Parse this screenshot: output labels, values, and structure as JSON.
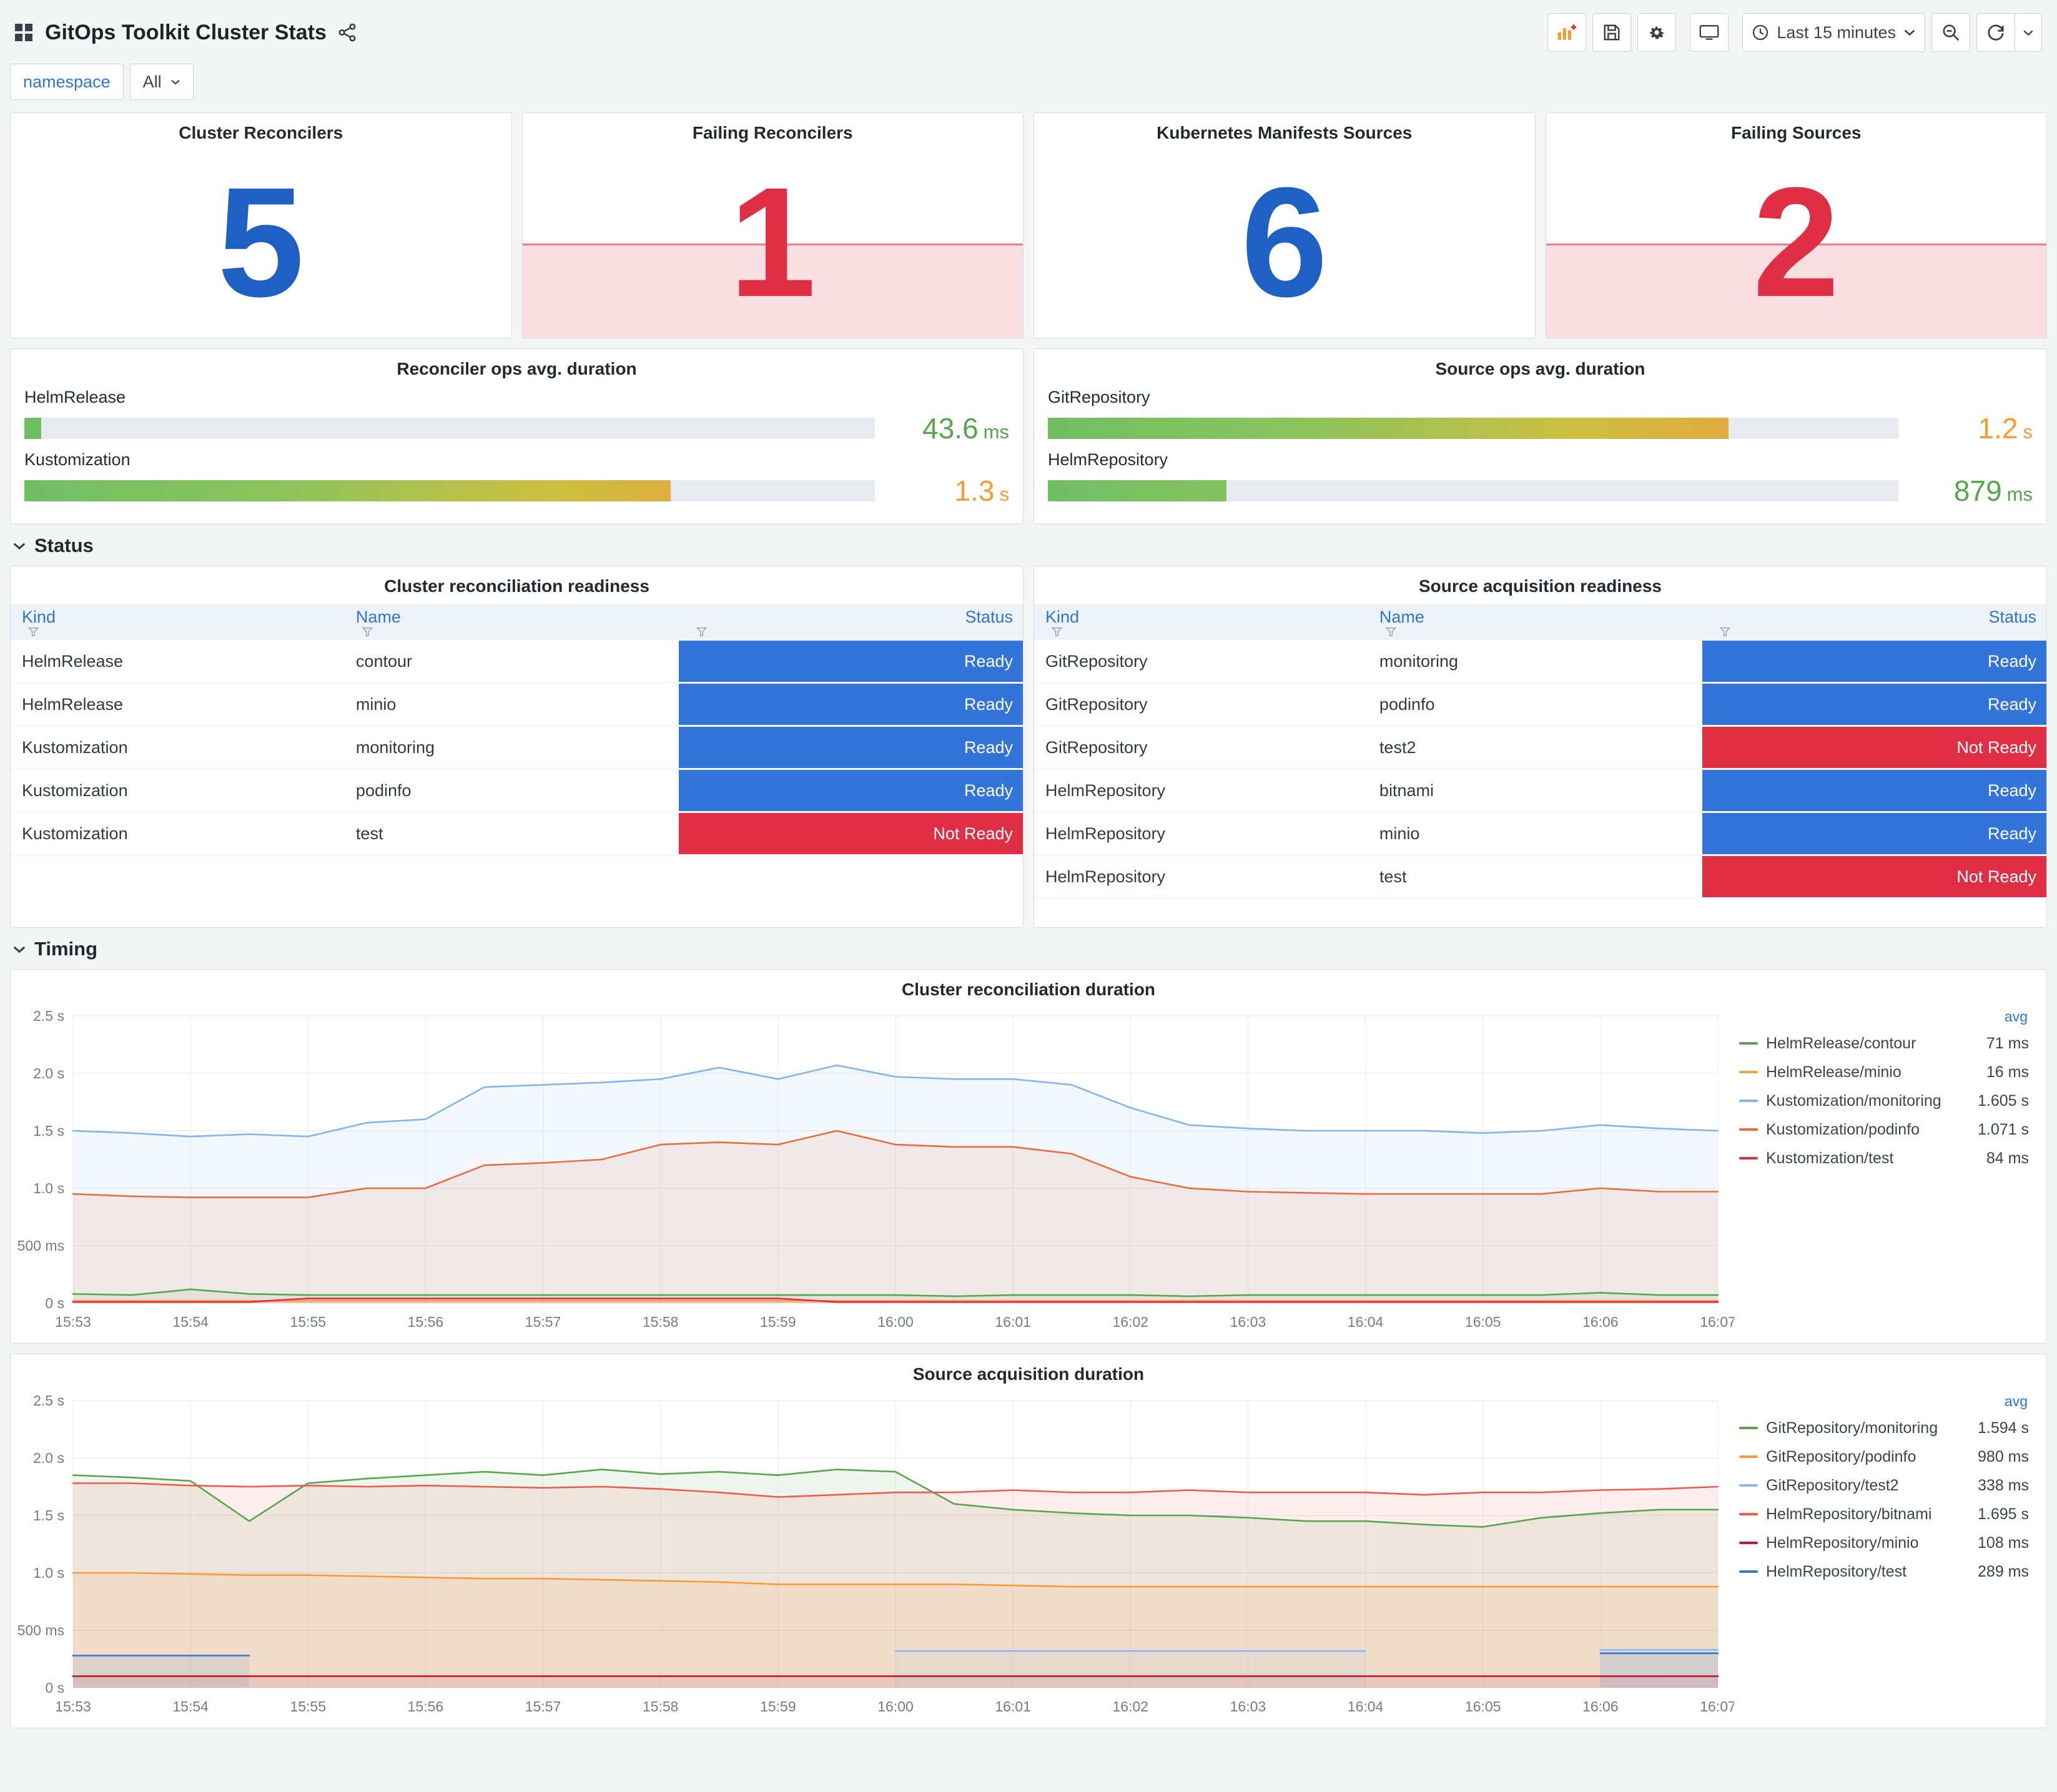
{
  "header": {
    "title": "GitOps Toolkit Cluster Stats",
    "time_range": "Last 15 minutes"
  },
  "variables": {
    "label": "namespace",
    "value": "All"
  },
  "colors": {
    "accent_blue": "#1f60c4",
    "alert_red": "#e02f44",
    "ready": "#3274d9",
    "not_ready": "#e02f44"
  },
  "stats": [
    {
      "title": "Cluster Reconcilers",
      "value": "5",
      "alert": false
    },
    {
      "title": "Failing Reconcilers",
      "value": "1",
      "alert": true
    },
    {
      "title": "Kubernetes Manifests Sources",
      "value": "6",
      "alert": false
    },
    {
      "title": "Failing Sources",
      "value": "2",
      "alert": true
    }
  ],
  "gauges": [
    {
      "title": "Reconciler ops avg. duration",
      "rows": [
        {
          "label": "HelmRelease",
          "value": "43.6",
          "unit": "ms",
          "pct": 2,
          "value_color": "#56a64b"
        },
        {
          "label": "Kustomization",
          "value": "1.3",
          "unit": "s",
          "pct": 76,
          "value_color": "#ff9830"
        }
      ]
    },
    {
      "title": "Source ops avg. duration",
      "rows": [
        {
          "label": "GitRepository",
          "value": "1.2",
          "unit": "s",
          "pct": 80,
          "value_color": "#ff9830"
        },
        {
          "label": "HelmRepository",
          "value": "879",
          "unit": "ms",
          "pct": 21,
          "value_color": "#56a64b"
        }
      ]
    }
  ],
  "rows": {
    "status": "Status",
    "timing": "Timing"
  },
  "tables": [
    {
      "title": "Cluster reconciliation readiness",
      "columns": [
        "Kind",
        "Name",
        "Status"
      ],
      "rows": [
        [
          "HelmRelease",
          "contour",
          "Ready"
        ],
        [
          "HelmRelease",
          "minio",
          "Ready"
        ],
        [
          "Kustomization",
          "monitoring",
          "Ready"
        ],
        [
          "Kustomization",
          "podinfo",
          "Ready"
        ],
        [
          "Kustomization",
          "test",
          "Not Ready"
        ]
      ]
    },
    {
      "title": "Source acquisition readiness",
      "columns": [
        "Kind",
        "Name",
        "Status"
      ],
      "rows": [
        [
          "GitRepository",
          "monitoring",
          "Ready"
        ],
        [
          "GitRepository",
          "podinfo",
          "Ready"
        ],
        [
          "GitRepository",
          "test2",
          "Not Ready"
        ],
        [
          "HelmRepository",
          "bitnami",
          "Ready"
        ],
        [
          "HelmRepository",
          "minio",
          "Ready"
        ],
        [
          "HelmRepository",
          "test",
          "Not Ready"
        ]
      ]
    }
  ],
  "chart_data": [
    {
      "type": "line",
      "title": "Cluster reconciliation duration",
      "x": [
        "15:53",
        "15:54",
        "15:55",
        "15:56",
        "15:57",
        "15:58",
        "15:59",
        "16:00",
        "16:01",
        "16:02",
        "16:03",
        "16:04",
        "16:05",
        "16:06",
        "16:07"
      ],
      "ylim": [
        0,
        2.5
      ],
      "y_unit": "seconds",
      "grid": true,
      "legend_position": "right",
      "legend_value_label": "avg",
      "y_ticks": [
        {
          "v": 0,
          "label": "0 s"
        },
        {
          "v": 0.5,
          "label": "500 ms"
        },
        {
          "v": 1,
          "label": "1.0 s"
        },
        {
          "v": 1.5,
          "label": "1.5 s"
        },
        {
          "v": 2,
          "label": "2.0 s"
        },
        {
          "v": 2.5,
          "label": "2.5 s"
        }
      ],
      "series": [
        {
          "name": "HelmRelease/contour",
          "color": "#56a64b",
          "avg": "71 ms",
          "values": [
            0.08,
            0.07,
            0.12,
            0.08,
            0.07,
            0.07,
            0.07,
            0.07,
            0.07,
            0.07,
            0.07,
            0.07,
            0.07,
            0.07,
            0.07,
            0.06,
            0.07,
            0.07,
            0.07,
            0.06,
            0.07,
            0.07,
            0.07,
            0.07,
            0.07,
            0.07,
            0.09,
            0.07,
            0.07
          ]
        },
        {
          "name": "HelmRelease/minio",
          "color": "#ffa040",
          "avg": "16 ms",
          "values": [
            0.02,
            0.02,
            0.02,
            0.02,
            0.02,
            0.02,
            0.02,
            0.02,
            0.02,
            0.02,
            0.02,
            0.02,
            0.02,
            0.02,
            0.02,
            0.02,
            0.02,
            0.02,
            0.02,
            0.02,
            0.02,
            0.02,
            0.02,
            0.02,
            0.02,
            0.02,
            0.02,
            0.02,
            0.02
          ]
        },
        {
          "name": "Kustomization/monitoring",
          "color": "#7eb6f0",
          "avg": "1.605 s",
          "values": [
            1.5,
            1.48,
            1.45,
            1.47,
            1.45,
            1.57,
            1.6,
            1.88,
            1.9,
            1.92,
            1.95,
            2.05,
            1.95,
            2.07,
            1.97,
            1.95,
            1.95,
            1.9,
            1.7,
            1.55,
            1.52,
            1.5,
            1.5,
            1.5,
            1.48,
            1.5,
            1.55,
            1.52,
            1.5
          ]
        },
        {
          "name": "Kustomization/podinfo",
          "color": "#ef6a3b",
          "avg": "1.071 s",
          "values": [
            0.95,
            0.93,
            0.92,
            0.92,
            0.92,
            1.0,
            1.0,
            1.2,
            1.22,
            1.25,
            1.38,
            1.4,
            1.38,
            1.5,
            1.38,
            1.36,
            1.36,
            1.3,
            1.1,
            1.0,
            0.97,
            0.96,
            0.95,
            0.95,
            0.95,
            0.95,
            1.0,
            0.97,
            0.97
          ]
        },
        {
          "name": "Kustomization/test",
          "color": "#e02f44",
          "avg": "84 ms",
          "values": [
            0.01,
            0.01,
            0.01,
            0.01,
            0.04,
            0.04,
            0.04,
            0.04,
            0.04,
            0.04,
            0.04,
            0.04,
            0.04,
            0.01,
            0.01,
            0.01,
            0.01,
            0.01,
            0.01,
            0.01,
            0.01,
            0.01,
            0.01,
            0.01,
            0.01,
            0.01,
            0.01,
            0.01,
            0.01
          ]
        }
      ]
    },
    {
      "type": "line",
      "title": "Source acquisition duration",
      "x": [
        "15:53",
        "15:54",
        "15:55",
        "15:56",
        "15:57",
        "15:58",
        "15:59",
        "16:00",
        "16:01",
        "16:02",
        "16:03",
        "16:04",
        "16:05",
        "16:06",
        "16:07"
      ],
      "ylim": [
        0,
        2.5
      ],
      "y_unit": "seconds",
      "grid": true,
      "legend_position": "right",
      "legend_value_label": "avg",
      "y_ticks": [
        {
          "v": 0,
          "label": "0 s"
        },
        {
          "v": 0.5,
          "label": "500 ms"
        },
        {
          "v": 1,
          "label": "1.0 s"
        },
        {
          "v": 1.5,
          "label": "1.5 s"
        },
        {
          "v": 2,
          "label": "2.0 s"
        },
        {
          "v": 2.5,
          "label": "2.5 s"
        }
      ],
      "series": [
        {
          "name": "GitRepository/monitoring",
          "color": "#56a64b",
          "avg": "1.594 s",
          "values": [
            1.85,
            1.83,
            1.8,
            1.45,
            1.78,
            1.82,
            1.85,
            1.88,
            1.85,
            1.9,
            1.86,
            1.88,
            1.85,
            1.9,
            1.88,
            1.6,
            1.55,
            1.52,
            1.5,
            1.5,
            1.48,
            1.45,
            1.45,
            1.42,
            1.4,
            1.48,
            1.52,
            1.55,
            1.55
          ]
        },
        {
          "name": "GitRepository/podinfo",
          "color": "#ff9830",
          "avg": "980 ms",
          "values": [
            1.0,
            1.0,
            0.99,
            0.98,
            0.98,
            0.97,
            0.96,
            0.95,
            0.95,
            0.94,
            0.93,
            0.92,
            0.9,
            0.9,
            0.9,
            0.9,
            0.89,
            0.88,
            0.88,
            0.88,
            0.88,
            0.88,
            0.88,
            0.88,
            0.88,
            0.88,
            0.88,
            0.88,
            0.88
          ]
        },
        {
          "name": "GitRepository/test2",
          "color": "#8ab8ff",
          "avg": "338 ms",
          "values": [
            null,
            null,
            null,
            null,
            null,
            null,
            null,
            null,
            null,
            null,
            null,
            null,
            null,
            null,
            0.32,
            0.32,
            0.32,
            0.32,
            0.32,
            0.32,
            0.32,
            0.32,
            0.32,
            null,
            null,
            null,
            0.33,
            0.33,
            0.33
          ]
        },
        {
          "name": "HelmRepository/bitnami",
          "color": "#f2594c",
          "avg": "1.695 s",
          "values": [
            1.78,
            1.78,
            1.76,
            1.75,
            1.76,
            1.75,
            1.76,
            1.75,
            1.74,
            1.75,
            1.73,
            1.7,
            1.66,
            1.68,
            1.7,
            1.7,
            1.72,
            1.7,
            1.7,
            1.72,
            1.7,
            1.7,
            1.7,
            1.68,
            1.7,
            1.7,
            1.72,
            1.73,
            1.75
          ]
        },
        {
          "name": "HelmRepository/minio",
          "color": "#c4162a",
          "avg": "108 ms",
          "values": [
            0.1,
            0.1,
            0.1,
            0.1,
            0.1,
            0.1,
            0.1,
            0.1,
            0.1,
            0.1,
            0.1,
            0.1,
            0.1,
            0.1,
            0.1,
            0.1,
            0.1,
            0.1,
            0.1,
            0.1,
            0.1,
            0.1,
            0.1,
            0.1,
            0.1,
            0.1,
            0.1,
            0.1,
            0.1
          ]
        },
        {
          "name": "HelmRepository/test",
          "color": "#3274d9",
          "avg": "289 ms",
          "values": [
            0.28,
            0.28,
            0.28,
            0.28,
            null,
            null,
            null,
            null,
            null,
            null,
            null,
            null,
            null,
            null,
            null,
            null,
            null,
            null,
            null,
            null,
            null,
            null,
            null,
            null,
            null,
            null,
            0.3,
            0.3,
            0.3
          ]
        }
      ]
    }
  ]
}
